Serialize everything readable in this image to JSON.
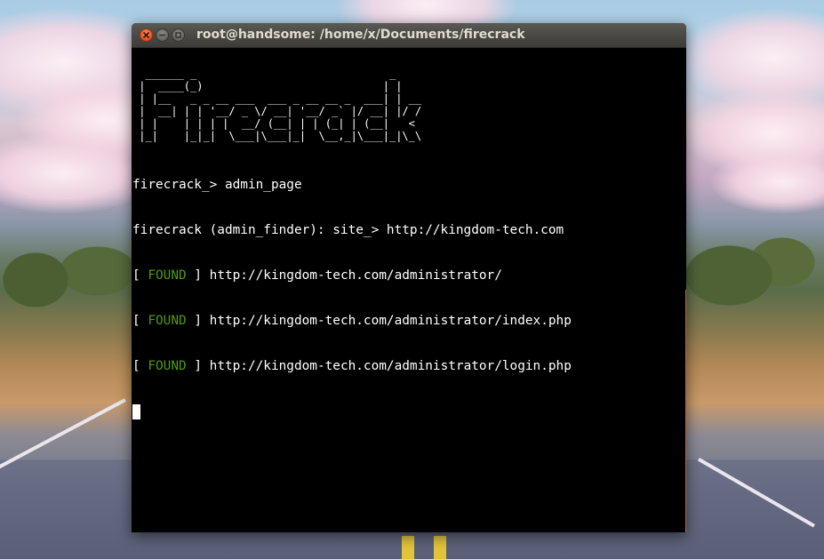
{
  "window": {
    "title": "root@handsome: /home/x/Documents/firecrack",
    "accent_close": "#e85c2d"
  },
  "terminal": {
    "banner": [
      "  ______ _                              _",
      " |  ____(_)                            | |",
      " | |__   _ _ __ ___  ___ _ __ __ _  ___| | __",
      " |  __| | | '__/ _ \\/ __| '__/ _` |/ __| |/ /",
      " | |    | | | |  __/ (__| | | (_| | (__|   <",
      " |_|    |_|_|  \\___|\\___|_|  \\__,_|\\___|_|\\_\\"
    ],
    "lines": [
      {
        "type": "text",
        "text": "firecrack_> admin_page"
      },
      {
        "type": "text",
        "text": "firecrack (admin_finder): site_> http://kingdom-tech.com"
      },
      {
        "type": "found",
        "open": "[ ",
        "status": "FOUND",
        "close": " ] ",
        "url": "http://kingdom-tech.com/administrator/"
      },
      {
        "type": "found",
        "open": "[ ",
        "status": "FOUND",
        "close": " ] ",
        "url": "http://kingdom-tech.com/administrator/index.php"
      },
      {
        "type": "found",
        "open": "[ ",
        "status": "FOUND",
        "close": " ] ",
        "url": "http://kingdom-tech.com/administrator/login.php"
      }
    ],
    "found_color": "#4e9a06",
    "text_color": "#ffffff",
    "background": "#000000"
  },
  "icons": {
    "close": "close-icon",
    "minimize": "minimize-icon",
    "maximize": "maximize-icon"
  }
}
